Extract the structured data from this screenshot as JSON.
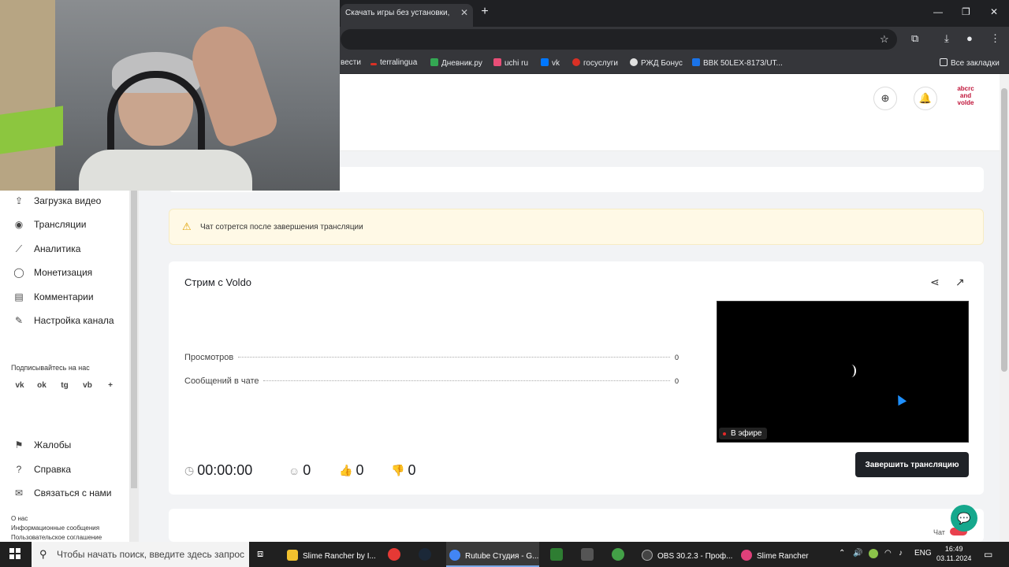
{
  "browser": {
    "tab_title": "Скачать игры без установки, ",
    "tab_close": "✕",
    "new_tab": "+",
    "bookmarks": [
      {
        "label": "вести",
        "color": ""
      },
      {
        "label": "terralingua",
        "color": "#d93025"
      },
      {
        "label": "Дневник.ру",
        "color": "#34a853"
      },
      {
        "label": "uchi ru",
        "color": "#e94e77"
      },
      {
        "label": "vk",
        "color": "#0077ff"
      },
      {
        "label": "госуслуги",
        "color": "#d93025"
      },
      {
        "label": "РЖД Бонус",
        "color": "#e0e0e0"
      },
      {
        "label": "ВВК 50LEX-8173/UT...",
        "color": "#1a73e8"
      }
    ],
    "all_bookmarks": "Все закладки"
  },
  "header": {
    "avatar_text": "abcrc and volde"
  },
  "sidebar": {
    "items": [
      {
        "icon": "⇪",
        "label": "Загрузка видео"
      },
      {
        "icon": "◉",
        "label": "Трансляции"
      },
      {
        "icon": "⟋",
        "label": "Аналитика"
      },
      {
        "icon": "◯",
        "label": "Монетизация"
      },
      {
        "icon": "▤",
        "label": "Комментарии"
      },
      {
        "icon": "✎",
        "label": "Настройка канала"
      }
    ],
    "subscribe_label": "Подписывайтесь на нас",
    "socials": [
      "vk",
      "ok",
      "tg",
      "vb",
      "+"
    ],
    "bottom_items": [
      {
        "icon": "⚑",
        "label": "Жалобы"
      },
      {
        "icon": "?",
        "label": "Справка"
      },
      {
        "icon": "✉",
        "label": "Связаться с нами"
      }
    ],
    "footer_links": [
      "О нас",
      "Информационные сообщения",
      "Пользовательское соглашение"
    ]
  },
  "warning": {
    "text": "Чат сотрется после завершения трансляции"
  },
  "stream": {
    "title": "Стрим с Voldo",
    "stats": [
      {
        "label": "Просмотров",
        "value": "0"
      },
      {
        "label": "Сообщений в чате",
        "value": "0"
      }
    ],
    "live_label": "В эфире",
    "duration": "00:00:00",
    "viewers": "0",
    "likes": "0",
    "dislikes": "0",
    "end_button": "Завершить трансляцию"
  },
  "chat_toggle_label": "Чат",
  "taskbar": {
    "search_placeholder": "Чтобы начать поиск, введите здесь запрос",
    "apps": [
      {
        "label": "Slime Rancher by I...",
        "color": "#f2c12e"
      },
      {
        "label": "Rutube Студия - G...",
        "color": "#4285f4"
      },
      {
        "label": "OBS 30.2.3 - Проф...",
        "color": "#444444"
      },
      {
        "label": "Slime Rancher",
        "color": "#e0407a"
      }
    ],
    "lang": "ENG",
    "time": "16:49",
    "date": "03.11.2024"
  }
}
